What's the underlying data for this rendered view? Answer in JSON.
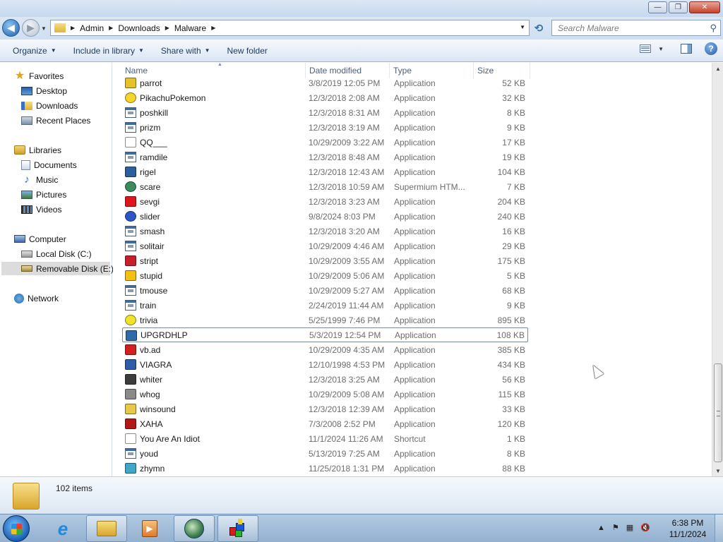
{
  "window": {
    "buttons": {
      "minimize": "—",
      "maximize": "❐",
      "close": "✕"
    }
  },
  "address": {
    "path": [
      "Admin",
      "Downloads",
      "Malware"
    ],
    "search_placeholder": "Search Malware"
  },
  "toolbar": {
    "organize": "Organize",
    "include_in_library": "Include in library",
    "share_with": "Share with",
    "new_folder": "New folder"
  },
  "nav": {
    "favorites": "Favorites",
    "desktop": "Desktop",
    "downloads": "Downloads",
    "recent_places": "Recent Places",
    "libraries": "Libraries",
    "documents": "Documents",
    "music": "Music",
    "pictures": "Pictures",
    "videos": "Videos",
    "computer": "Computer",
    "local_disk": "Local Disk (C:)",
    "removable_disk": "Removable Disk (E:)",
    "network": "Network"
  },
  "columns": {
    "name": "Name",
    "date_modified": "Date modified",
    "type": "Type",
    "size": "Size"
  },
  "files": [
    {
      "name": "parrot",
      "date": "3/8/2019 12:05 PM",
      "type": "Application",
      "size": "52 KB",
      "icon": "parrot-icon",
      "color": "#e6c12a"
    },
    {
      "name": "PikachuPokemon",
      "date": "12/3/2018 2:08 AM",
      "type": "Application",
      "size": "32 KB",
      "icon": "pikachu-icon",
      "color": "#f3d52c"
    },
    {
      "name": "poshkill",
      "date": "12/3/2018 8:31 AM",
      "type": "Application",
      "size": "8 KB",
      "icon": "app-icon",
      "color": ""
    },
    {
      "name": "prizm",
      "date": "12/3/2018 3:19 AM",
      "type": "Application",
      "size": "9 KB",
      "icon": "app-icon",
      "color": ""
    },
    {
      "name": "QQ___",
      "date": "10/29/2009 3:22 AM",
      "type": "Application",
      "size": "17 KB",
      "icon": "qq-icon",
      "color": "#ffffff"
    },
    {
      "name": "ramdile",
      "date": "12/3/2018 8:48 AM",
      "type": "Application",
      "size": "19 KB",
      "icon": "app-icon",
      "color": ""
    },
    {
      "name": "rigel",
      "date": "12/3/2018 12:43 AM",
      "type": "Application",
      "size": "104 KB",
      "icon": "rigel-icon",
      "color": "#2b5f9e"
    },
    {
      "name": "scare",
      "date": "12/3/2018 10:59 AM",
      "type": "Supermium HTM...",
      "size": "7 KB",
      "icon": "html-globe-icon",
      "color": "#3b8b5c"
    },
    {
      "name": "sevgi",
      "date": "12/3/2018 3:23 AM",
      "type": "Application",
      "size": "204 KB",
      "icon": "heart-icon",
      "color": "#e0161b"
    },
    {
      "name": "slider",
      "date": "9/8/2024 8:03 PM",
      "type": "Application",
      "size": "240 KB",
      "icon": "slider-icon",
      "color": "#2c56c8"
    },
    {
      "name": "smash",
      "date": "12/3/2018 3:20 AM",
      "type": "Application",
      "size": "16 KB",
      "icon": "app-icon",
      "color": ""
    },
    {
      "name": "solitair",
      "date": "10/29/2009 4:46 AM",
      "type": "Application",
      "size": "29 KB",
      "icon": "app-icon",
      "color": ""
    },
    {
      "name": "stript",
      "date": "10/29/2009 3:55 AM",
      "type": "Application",
      "size": "175 KB",
      "icon": "stript-icon",
      "color": "#c8202b"
    },
    {
      "name": "stupid",
      "date": "10/29/2009 5:06 AM",
      "type": "Application",
      "size": "5 KB",
      "icon": "warning-icon",
      "color": "#f2c012"
    },
    {
      "name": "tmouse",
      "date": "10/29/2009 5:27 AM",
      "type": "Application",
      "size": "68 KB",
      "icon": "app-icon",
      "color": ""
    },
    {
      "name": "train",
      "date": "2/24/2019 11:44 AM",
      "type": "Application",
      "size": "9 KB",
      "icon": "app-icon",
      "color": ""
    },
    {
      "name": "trivia",
      "date": "5/25/1999 7:46 PM",
      "type": "Application",
      "size": "895 KB",
      "icon": "smiley-icon",
      "color": "#f2e22a"
    },
    {
      "name": "UPGRDHLP",
      "date": "5/3/2019 12:54 PM",
      "type": "Application",
      "size": "108 KB",
      "icon": "upgrdhlp-icon",
      "color": "#2f6ba8"
    },
    {
      "name": "vb.ad",
      "date": "10/29/2009 4:35 AM",
      "type": "Application",
      "size": "385 KB",
      "icon": "vbad-icon",
      "color": "#d41f1f"
    },
    {
      "name": "VIAGRA",
      "date": "12/10/1998 4:53 PM",
      "type": "Application",
      "size": "434 KB",
      "icon": "viagra-icon",
      "color": "#2f5ea8"
    },
    {
      "name": "whiter",
      "date": "12/3/2018 3:25 AM",
      "type": "Application",
      "size": "56 KB",
      "icon": "whiter-icon",
      "color": "#3d3d3d"
    },
    {
      "name": "whog",
      "date": "10/29/2009 5:08 AM",
      "type": "Application",
      "size": "115 KB",
      "icon": "whog-icon",
      "color": "#8a8a8a"
    },
    {
      "name": "winsound",
      "date": "12/3/2018 12:39 AM",
      "type": "Application",
      "size": "33 KB",
      "icon": "folder-icon",
      "color": "#e8c74a"
    },
    {
      "name": "XAHA",
      "date": "7/3/2008 2:52 PM",
      "type": "Application",
      "size": "120 KB",
      "icon": "xaha-icon",
      "color": "#b21818"
    },
    {
      "name": "You Are An Idiot",
      "date": "11/1/2024 11:26 AM",
      "type": "Shortcut",
      "size": "1 KB",
      "icon": "shortcut-icon",
      "color": "#ffffff"
    },
    {
      "name": "youd",
      "date": "5/13/2019 7:25 AM",
      "type": "Application",
      "size": "8 KB",
      "icon": "app-icon",
      "color": ""
    },
    {
      "name": "zhymn",
      "date": "11/25/2018 1:31 PM",
      "type": "Application",
      "size": "88 KB",
      "icon": "zhymn-icon",
      "color": "#3fa7c9"
    }
  ],
  "focused_file": "UPGRDHLP",
  "details": {
    "item_count": "102 items"
  },
  "taskbar": {
    "clock_time": "6:38 PM",
    "clock_date": "11/1/2024"
  },
  "colors": {
    "accent": "#1d5fad",
    "toolbar_text": "#1e395b",
    "selected_nav": "#dcdcdc"
  }
}
